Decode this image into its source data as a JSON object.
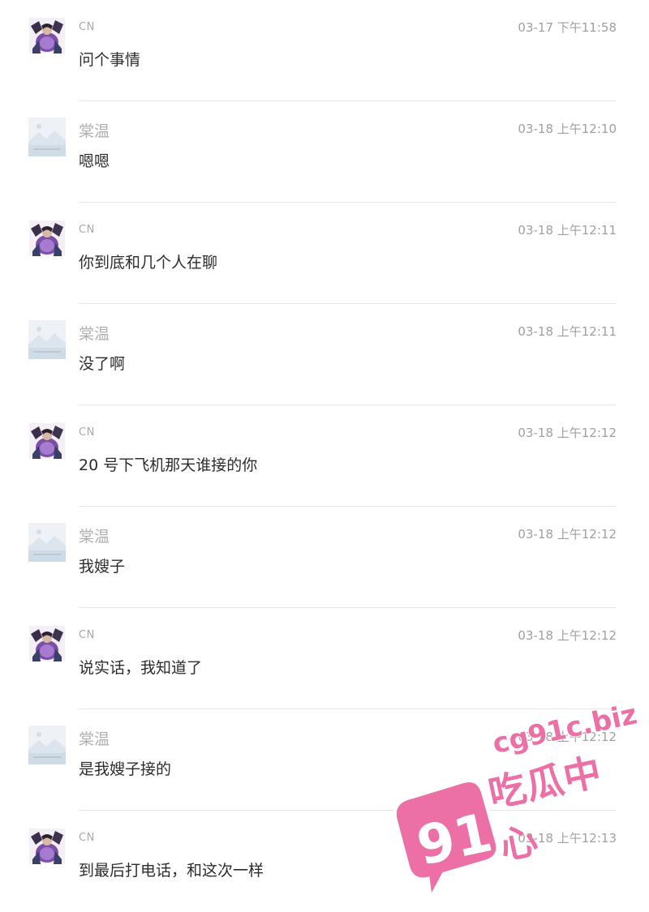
{
  "messages": [
    {
      "sender": "CN",
      "time": "03-17 下午11:58",
      "text": "问个事情",
      "avatar": "cn-avatar"
    },
    {
      "sender": "棠温",
      "time": "03-18 上午12:10",
      "text": "嗯嗯",
      "avatar": "placeholder-avatar"
    },
    {
      "sender": "CN",
      "time": "03-18 上午12:11",
      "text": "你到底和几个人在聊",
      "avatar": "cn-avatar"
    },
    {
      "sender": "棠温",
      "time": "03-18 上午12:11",
      "text": "没了啊",
      "avatar": "placeholder-avatar"
    },
    {
      "sender": "CN",
      "time": "03-18 上午12:12",
      "text": "20 号下飞机那天谁接的你",
      "avatar": "cn-avatar"
    },
    {
      "sender": "棠温",
      "time": "03-18 上午12:12",
      "text": "我嫂子",
      "avatar": "placeholder-avatar"
    },
    {
      "sender": "CN",
      "time": "03-18 上午12:12",
      "text": "说实话，我知道了",
      "avatar": "cn-avatar"
    },
    {
      "sender": "棠温",
      "time": "03-18 上午12:12",
      "text": "是我嫂子接的",
      "avatar": "placeholder-avatar"
    },
    {
      "sender": "CN",
      "time": "03-18 上午12:13",
      "text": "到最后打电话，和这次一样",
      "avatar": "cn-avatar"
    }
  ],
  "watermark": {
    "number": "91",
    "url": "cg91c.biz",
    "slogan": "吃瓜中心",
    "color": "#ec6fa5"
  },
  "colors": {
    "message_text": "#2c2c2c",
    "meta_text": "#a0a0a0",
    "divider": "#e6e6e6"
  }
}
